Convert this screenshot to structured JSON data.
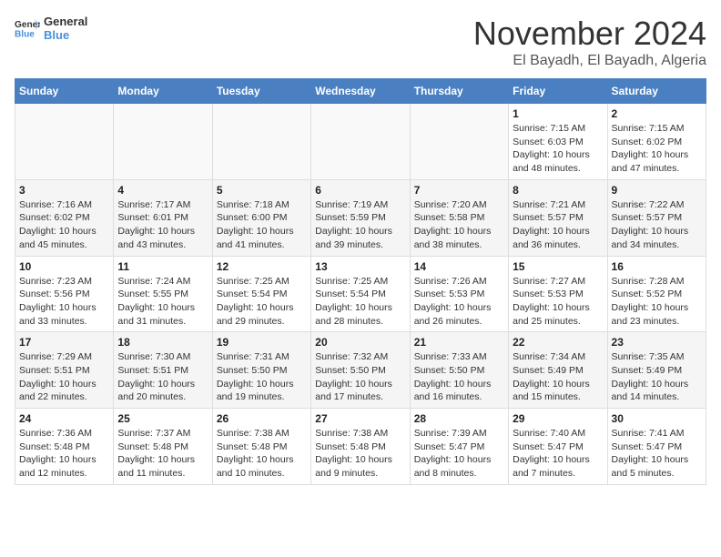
{
  "header": {
    "logo_general": "General",
    "logo_blue": "Blue",
    "month_title": "November 2024",
    "location": "El Bayadh, El Bayadh, Algeria"
  },
  "weekdays": [
    "Sunday",
    "Monday",
    "Tuesday",
    "Wednesday",
    "Thursday",
    "Friday",
    "Saturday"
  ],
  "rows": [
    {
      "cells": [
        {
          "day": "",
          "empty": true
        },
        {
          "day": "",
          "empty": true
        },
        {
          "day": "",
          "empty": true
        },
        {
          "day": "",
          "empty": true
        },
        {
          "day": "",
          "empty": true
        },
        {
          "day": "1",
          "sunrise": "7:15 AM",
          "sunset": "6:03 PM",
          "daylight": "10 hours and 48 minutes."
        },
        {
          "day": "2",
          "sunrise": "7:15 AM",
          "sunset": "6:02 PM",
          "daylight": "10 hours and 47 minutes."
        }
      ]
    },
    {
      "cells": [
        {
          "day": "3",
          "sunrise": "7:16 AM",
          "sunset": "6:02 PM",
          "daylight": "10 hours and 45 minutes."
        },
        {
          "day": "4",
          "sunrise": "7:17 AM",
          "sunset": "6:01 PM",
          "daylight": "10 hours and 43 minutes."
        },
        {
          "day": "5",
          "sunrise": "7:18 AM",
          "sunset": "6:00 PM",
          "daylight": "10 hours and 41 minutes."
        },
        {
          "day": "6",
          "sunrise": "7:19 AM",
          "sunset": "5:59 PM",
          "daylight": "10 hours and 39 minutes."
        },
        {
          "day": "7",
          "sunrise": "7:20 AM",
          "sunset": "5:58 PM",
          "daylight": "10 hours and 38 minutes."
        },
        {
          "day": "8",
          "sunrise": "7:21 AM",
          "sunset": "5:57 PM",
          "daylight": "10 hours and 36 minutes."
        },
        {
          "day": "9",
          "sunrise": "7:22 AM",
          "sunset": "5:57 PM",
          "daylight": "10 hours and 34 minutes."
        }
      ]
    },
    {
      "cells": [
        {
          "day": "10",
          "sunrise": "7:23 AM",
          "sunset": "5:56 PM",
          "daylight": "10 hours and 33 minutes."
        },
        {
          "day": "11",
          "sunrise": "7:24 AM",
          "sunset": "5:55 PM",
          "daylight": "10 hours and 31 minutes."
        },
        {
          "day": "12",
          "sunrise": "7:25 AM",
          "sunset": "5:54 PM",
          "daylight": "10 hours and 29 minutes."
        },
        {
          "day": "13",
          "sunrise": "7:25 AM",
          "sunset": "5:54 PM",
          "daylight": "10 hours and 28 minutes."
        },
        {
          "day": "14",
          "sunrise": "7:26 AM",
          "sunset": "5:53 PM",
          "daylight": "10 hours and 26 minutes."
        },
        {
          "day": "15",
          "sunrise": "7:27 AM",
          "sunset": "5:53 PM",
          "daylight": "10 hours and 25 minutes."
        },
        {
          "day": "16",
          "sunrise": "7:28 AM",
          "sunset": "5:52 PM",
          "daylight": "10 hours and 23 minutes."
        }
      ]
    },
    {
      "cells": [
        {
          "day": "17",
          "sunrise": "7:29 AM",
          "sunset": "5:51 PM",
          "daylight": "10 hours and 22 minutes."
        },
        {
          "day": "18",
          "sunrise": "7:30 AM",
          "sunset": "5:51 PM",
          "daylight": "10 hours and 20 minutes."
        },
        {
          "day": "19",
          "sunrise": "7:31 AM",
          "sunset": "5:50 PM",
          "daylight": "10 hours and 19 minutes."
        },
        {
          "day": "20",
          "sunrise": "7:32 AM",
          "sunset": "5:50 PM",
          "daylight": "10 hours and 17 minutes."
        },
        {
          "day": "21",
          "sunrise": "7:33 AM",
          "sunset": "5:50 PM",
          "daylight": "10 hours and 16 minutes."
        },
        {
          "day": "22",
          "sunrise": "7:34 AM",
          "sunset": "5:49 PM",
          "daylight": "10 hours and 15 minutes."
        },
        {
          "day": "23",
          "sunrise": "7:35 AM",
          "sunset": "5:49 PM",
          "daylight": "10 hours and 14 minutes."
        }
      ]
    },
    {
      "cells": [
        {
          "day": "24",
          "sunrise": "7:36 AM",
          "sunset": "5:48 PM",
          "daylight": "10 hours and 12 minutes."
        },
        {
          "day": "25",
          "sunrise": "7:37 AM",
          "sunset": "5:48 PM",
          "daylight": "10 hours and 11 minutes."
        },
        {
          "day": "26",
          "sunrise": "7:38 AM",
          "sunset": "5:48 PM",
          "daylight": "10 hours and 10 minutes."
        },
        {
          "day": "27",
          "sunrise": "7:38 AM",
          "sunset": "5:48 PM",
          "daylight": "10 hours and 9 minutes."
        },
        {
          "day": "28",
          "sunrise": "7:39 AM",
          "sunset": "5:47 PM",
          "daylight": "10 hours and 8 minutes."
        },
        {
          "day": "29",
          "sunrise": "7:40 AM",
          "sunset": "5:47 PM",
          "daylight": "10 hours and 7 minutes."
        },
        {
          "day": "30",
          "sunrise": "7:41 AM",
          "sunset": "5:47 PM",
          "daylight": "10 hours and 5 minutes."
        }
      ]
    }
  ]
}
